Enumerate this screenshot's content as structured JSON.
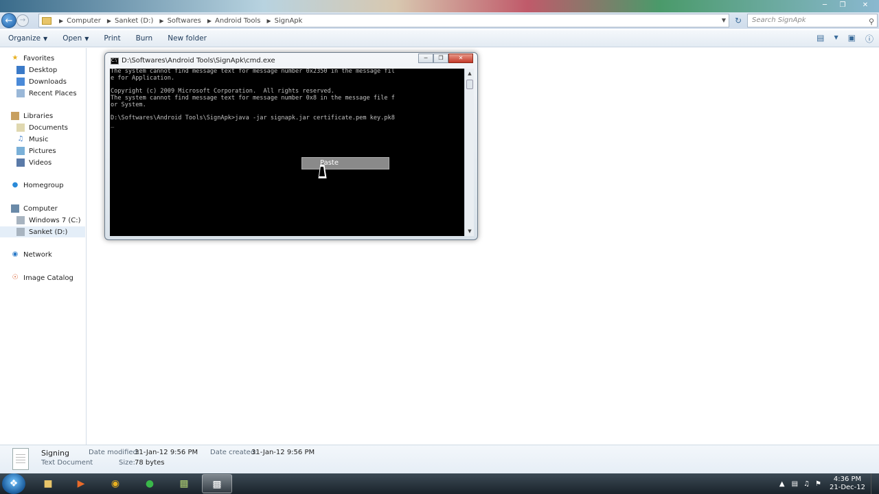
{
  "address": {
    "crumbs": [
      "Computer",
      "Sanket (D:)",
      "Softwares",
      "Android Tools",
      "SignApk"
    ],
    "search_placeholder": "Search SignApk"
  },
  "toolbar": {
    "organize": "Organize",
    "open": "Open",
    "print": "Print",
    "burn": "Burn",
    "new_folder": "New folder"
  },
  "sidebar": {
    "favorites": "Favorites",
    "desktop": "Desktop",
    "downloads": "Downloads",
    "recent_places": "Recent Places",
    "libraries": "Libraries",
    "documents": "Documents",
    "music": "Music",
    "pictures": "Pictures",
    "videos": "Videos",
    "homegroup": "Homegroup",
    "computer": "Computer",
    "windows7": "Windows 7 (C:)",
    "sanket": "Sanket (D:)",
    "network": "Network",
    "image_catalog": "Image Catalog"
  },
  "cmd": {
    "title": "D:\\Softwares\\Android Tools\\SignApk\\cmd.exe",
    "console_text": "The system cannot find message text for message number 0x2350 in the message fil\ne for Application.\n\nCopyright (c) 2009 Microsoft Corporation.  All rights reserved.\nThe system cannot find message text for message number 0x8 in the message file f\nor System.\n\nD:\\Softwares\\Android Tools\\SignApk>java -jar signapk.jar certificate.pem key.pk8\n_",
    "context_menu_item": "Paste"
  },
  "details": {
    "name": "Signing",
    "type": "Text Document",
    "date_modified_label": "Date modified:",
    "date_modified": "31-Jan-12 9:56 PM",
    "size_label": "Size:",
    "size": "78 bytes",
    "date_created_label": "Date created:",
    "date_created": "31-Jan-12 9:56 PM"
  },
  "clock": {
    "time": "4:36 PM",
    "date": "21-Dec-12"
  }
}
